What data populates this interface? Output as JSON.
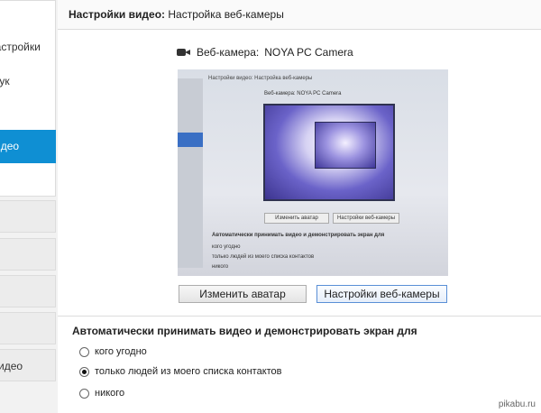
{
  "header": {
    "title": "Настройки видео:",
    "breadcrumb": "Настройка веб-камеры"
  },
  "sidebar": {
    "items": [
      {
        "label": "Настройки"
      },
      {
        "label": "Звук"
      },
      {
        "label": "Видео",
        "selected": true
      }
    ],
    "bottom_label": "Видео"
  },
  "webcam": {
    "label": "Веб-камера:",
    "device": "NOYA PC Camera",
    "icon": "webcam-icon"
  },
  "preview": {
    "header": "Настройки видео: Настройка веб-камеры",
    "cam_label": "Веб-камера:  NOYA PC Camera",
    "btn_avatar": "Изменить аватар",
    "btn_settings": "Настройки веб-камеры",
    "section_title": "Автоматически принимать видео и демонстрировать экран для",
    "opt1": "кого угодно",
    "opt2": "только людей из моего списка контактов",
    "opt3": "никого"
  },
  "buttons": {
    "change_avatar": "Изменить аватар",
    "webcam_settings": "Настройки веб-камеры"
  },
  "auto_accept": {
    "title": "Автоматически принимать видео и демонстрировать экран для",
    "options": [
      {
        "label": "кого угодно",
        "checked": false
      },
      {
        "label": "только людей из моего списка контактов",
        "checked": true
      },
      {
        "label": "никого",
        "checked": false
      }
    ]
  },
  "watermark": "pikabu.ru"
}
